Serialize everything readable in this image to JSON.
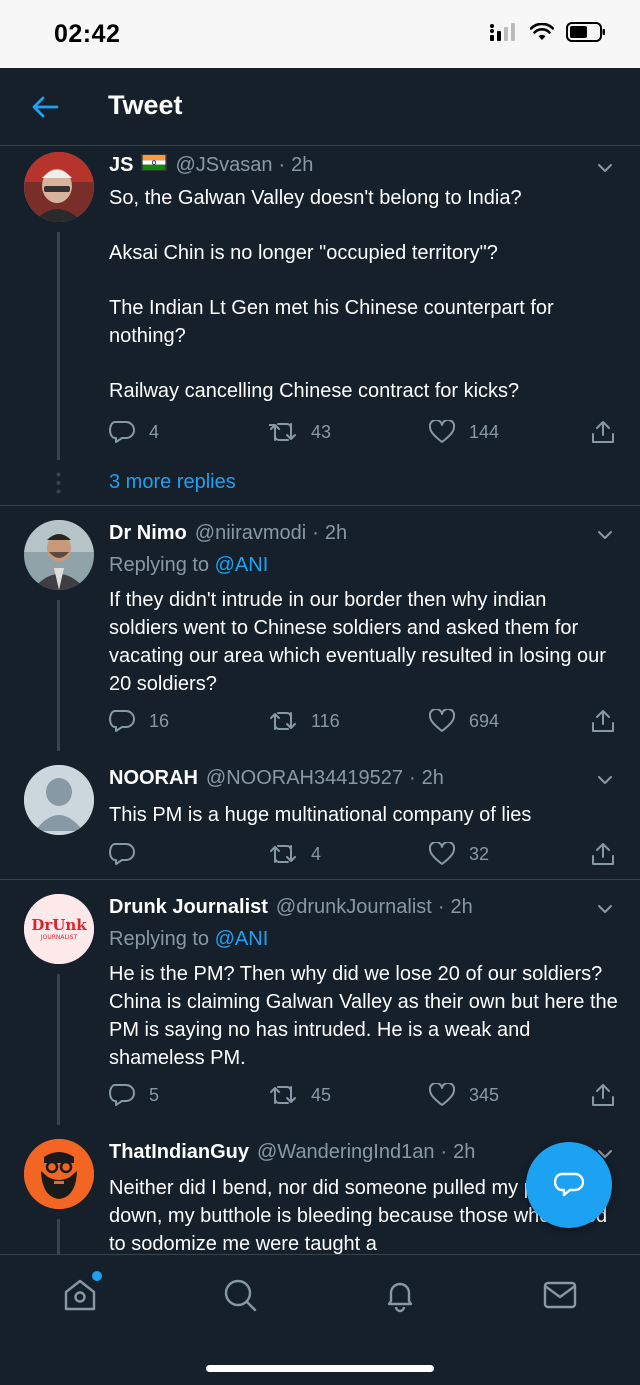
{
  "status_bar": {
    "time": "02:42"
  },
  "header": {
    "title": "Tweet"
  },
  "tweets": [
    {
      "name": "JS",
      "handle": "@JSvasan",
      "sep": "·",
      "time": "2h",
      "body": [
        "So, the Galwan Valley doesn't belong to India?",
        "Aksai Chin is no longer \"occupied territory\"?",
        "The Indian Lt Gen met his Chinese counterpart for nothing?",
        "Railway cancelling Chinese contract for kicks?"
      ],
      "replies": "4",
      "retweets": "43",
      "likes": "144",
      "more_replies": "3 more replies"
    },
    {
      "name": "Dr Nimo",
      "handle": "@niiravmodi",
      "sep": "·",
      "time": "2h",
      "replying_label": "Replying to",
      "replying_handle": "@ANI",
      "body": "If they didn't intrude in our border then why indian soldiers went to Chinese soldiers and asked them for vacating our area which eventually resulted in losing our 20 soldiers?",
      "replies": "16",
      "retweets": "116",
      "likes": "694"
    },
    {
      "name": "NOORAH",
      "handle": "@NOORAH34419527",
      "sep": "·",
      "time": "2h",
      "body": "This PM is a huge multinational company of lies",
      "replies": "",
      "retweets": "4",
      "likes": "32"
    },
    {
      "name": "Drunk Journalist",
      "handle": "@drunkJournalist",
      "sep": "·",
      "time": "2h",
      "avatar_text_top": "DrUnk",
      "avatar_text_bottom": "JOURNALIST",
      "replying_label": "Replying to",
      "replying_handle": "@ANI",
      "body": "He is the PM? Then why did we lose 20 of our soldiers? China is claiming Galwan Valley as their own but here the PM is saying no has intruded. He is a weak and shameless PM.",
      "replies": "5",
      "retweets": "45",
      "likes": "345"
    },
    {
      "name": "ThatIndianGuy",
      "handle": "@WanderingInd1an",
      "sep": "·",
      "time": "2h",
      "body": "Neither did I bend, nor did someone pulled my pants down, my butthole is bleeding because those who dared to sodomize me were taught a"
    }
  ],
  "colors": {
    "background": "#15202b",
    "accent": "#1da1f2",
    "secondary_text": "#8899a6",
    "divider": "#38444d"
  },
  "icons": {
    "status": [
      "signal-icon",
      "wifi-icon",
      "battery-icon"
    ],
    "tabs": [
      "home-icon",
      "search-icon",
      "bell-icon",
      "mail-icon"
    ],
    "actions": [
      "reply-icon",
      "retweet-icon",
      "heart-icon",
      "share-icon"
    ],
    "fab": "compose-reply-icon"
  }
}
